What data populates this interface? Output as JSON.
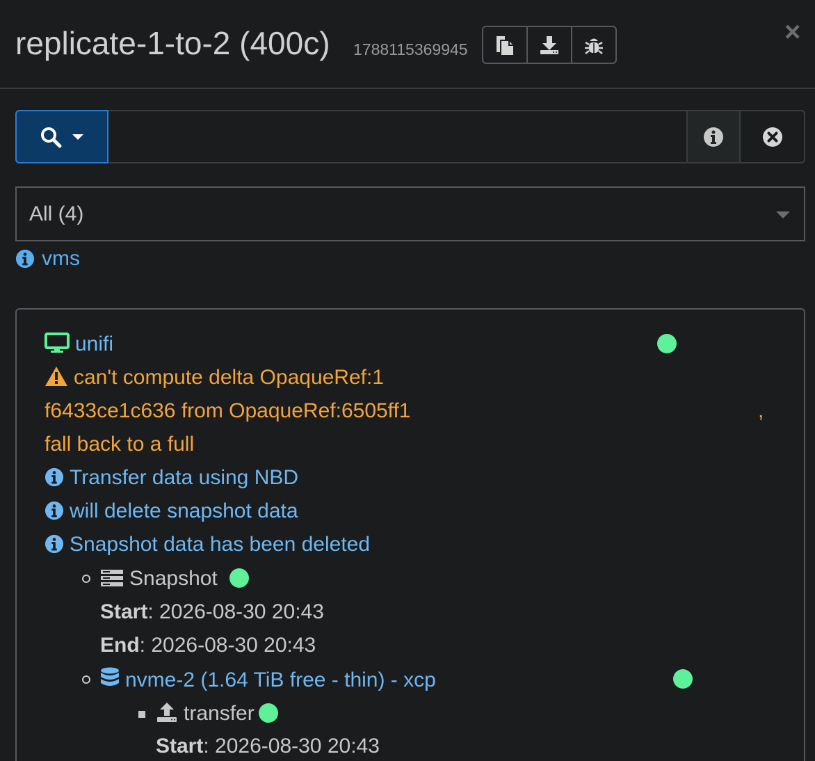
{
  "header": {
    "title": "replicate-1-to-2 (400c)",
    "job_id": "1788115369945",
    "buttons": [
      {
        "icon": "copy-icon"
      },
      {
        "icon": "download-icon"
      },
      {
        "icon": "bug-icon"
      }
    ],
    "close_label": "×"
  },
  "search": {
    "value": "",
    "placeholder": "",
    "search_icon": "search-icon",
    "info_icon": "info-circle-icon",
    "clear_icon": "close-circle-icon"
  },
  "filter": {
    "selected": "All (4)"
  },
  "vms_label": "vms",
  "task": {
    "vm_name": "unifi",
    "warning_line1": "can't compute delta OpaqueRef:1",
    "warning_line2": "f6433ce1c636 from OpaqueRef:6505ff1",
    "warning_comma": ",",
    "warning_line3": "fall back to a full",
    "info1": "Transfer data using NBD",
    "info2": "will delete snapshot data",
    "info3": "Snapshot data has been deleted",
    "snapshot": {
      "label": "Snapshot",
      "start_key": "Start",
      "start_value": ": 2026-08-30 20:43",
      "end_key": "End",
      "end_value": ": 2026-08-30 20:43"
    },
    "sr": {
      "label": "nvme-2 (1.64 TiB free - thin) - xcp",
      "transfer": {
        "label": "transfer",
        "start_key": "Start",
        "start_value": ": 2026-08-30 20:43"
      }
    },
    "status_color": "#5ff09a",
    "warning_color": "#f2a43c",
    "info_color": "#6fb7f2"
  }
}
